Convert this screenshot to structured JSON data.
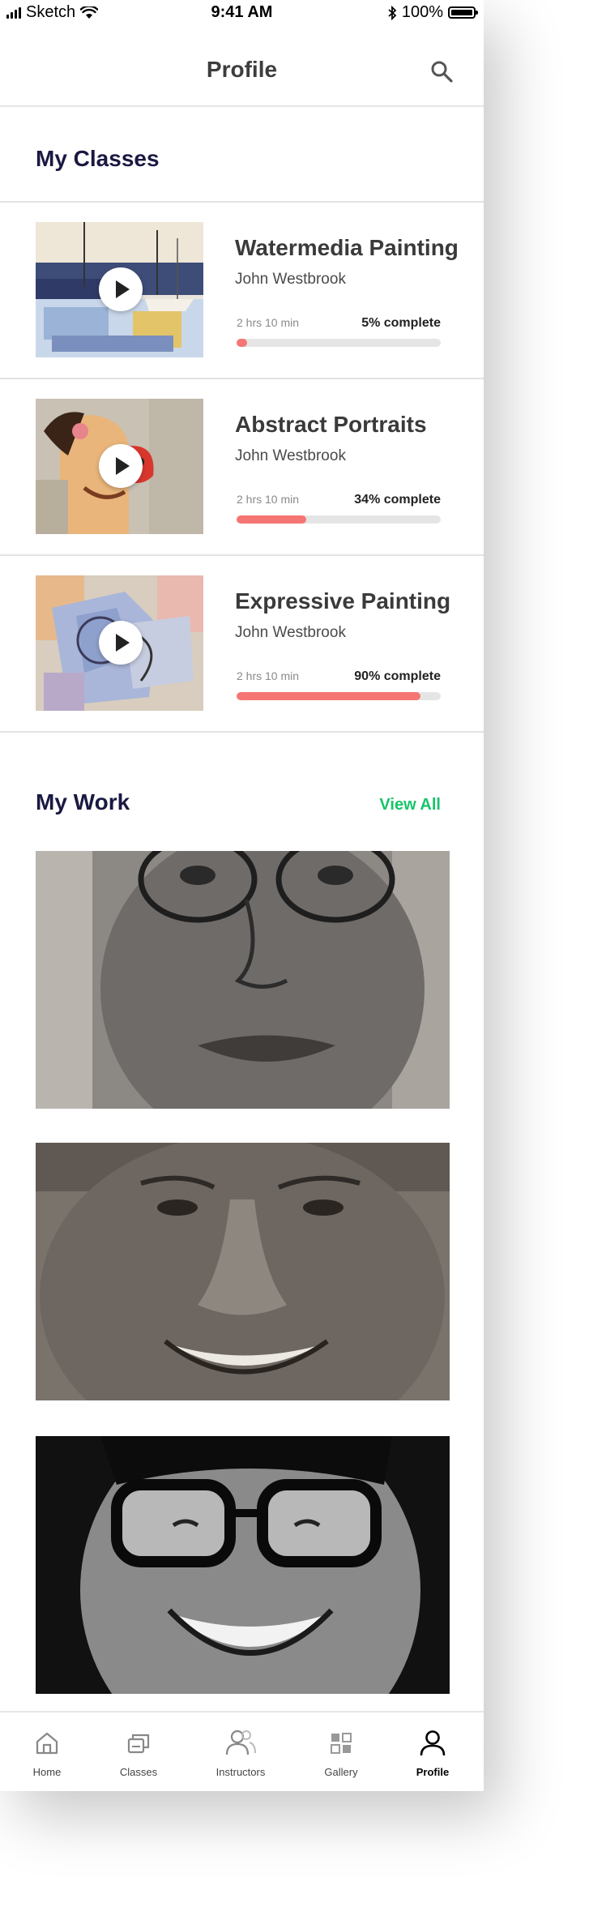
{
  "status_bar": {
    "carrier": "Sketch",
    "time": "9:41 AM",
    "battery": "100%"
  },
  "header": {
    "title": "Profile",
    "search_icon": "search-icon"
  },
  "my_classes": {
    "heading": "My Classes",
    "items": [
      {
        "title": "Watermedia Painting",
        "author": "John Westbrook",
        "duration": "2 hrs 10 min",
        "progress_label": "5% complete",
        "progress": 0.05
      },
      {
        "title": "Abstract Portraits",
        "author": "John Westbrook",
        "duration": "2 hrs 10 min",
        "progress_label": "34% complete",
        "progress": 0.34
      },
      {
        "title": "Expressive Painting",
        "author": "John Westbrook",
        "duration": "2 hrs 10 min",
        "progress_label": "90% complete",
        "progress": 0.9
      }
    ]
  },
  "my_work": {
    "heading": "My Work",
    "view_all": "View All"
  },
  "tabbar": {
    "items": [
      {
        "label": "Home",
        "icon": "home-icon"
      },
      {
        "label": "Classes",
        "icon": "classes-icon"
      },
      {
        "label": "Instructors",
        "icon": "instructors-icon"
      },
      {
        "label": "Gallery",
        "icon": "gallery-icon"
      },
      {
        "label": "Profile",
        "icon": "profile-icon",
        "active": true
      }
    ]
  },
  "colors": {
    "progress_fill": "#f57572",
    "accent_green": "#17c56a",
    "heading_navy": "#1a1942"
  }
}
